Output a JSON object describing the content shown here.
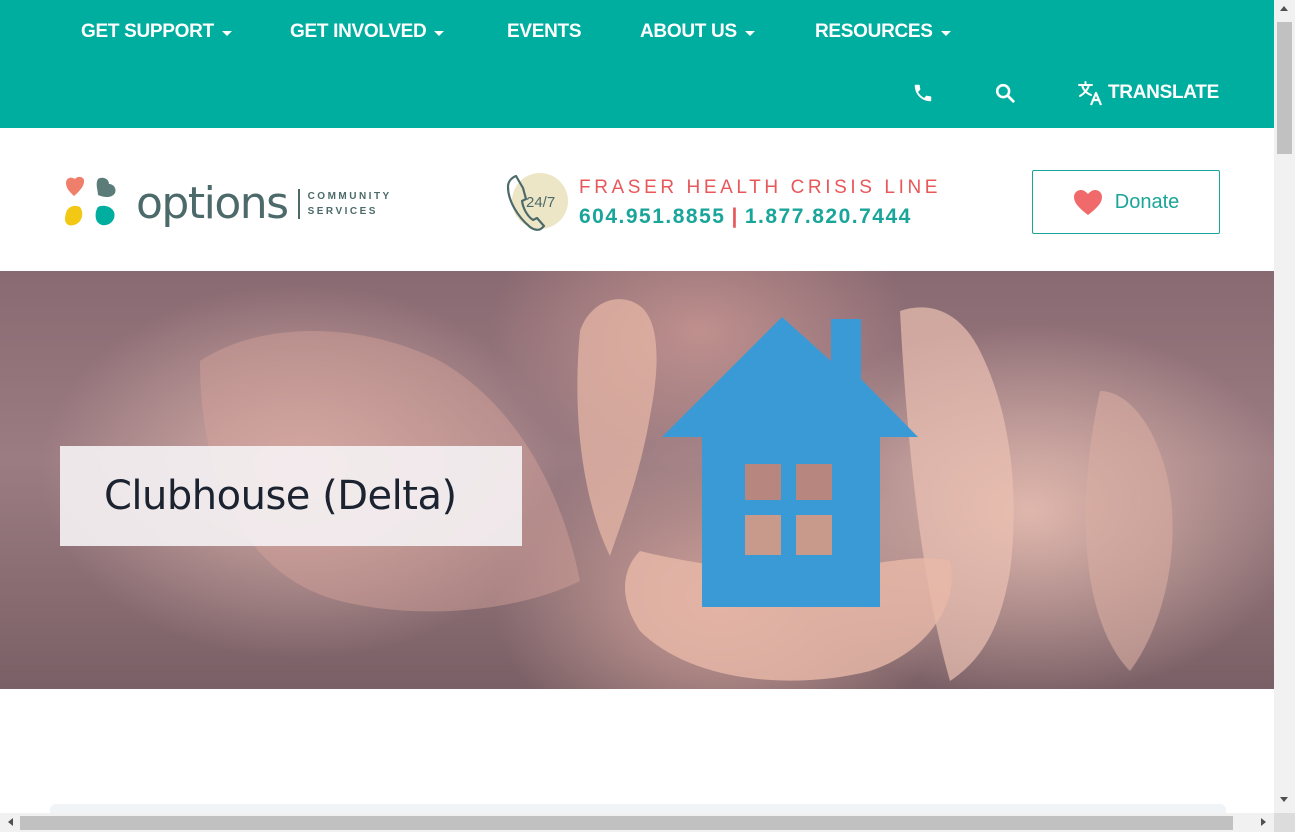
{
  "nav": {
    "items": [
      {
        "label": "GET SUPPORT",
        "dropdown": true
      },
      {
        "label": "GET INVOLVED",
        "dropdown": true
      },
      {
        "label": "EVENTS",
        "dropdown": false
      },
      {
        "label": "ABOUT US",
        "dropdown": true
      },
      {
        "label": "RESOURCES",
        "dropdown": true
      }
    ],
    "utility": {
      "phone_icon": "phone-icon",
      "search_icon": "search-icon",
      "translate_icon": "translate-icon",
      "translate_label": "TRANSLATE"
    }
  },
  "header": {
    "logo": {
      "word": "options",
      "sub_line1": "COMMUNITY",
      "sub_line2": "SERVICES"
    },
    "crisis": {
      "badge": "24/7",
      "title": "FRASER HEALTH CRISIS LINE",
      "phone1": "604.951.8855",
      "separator": "|",
      "phone2": "1.877.820.7444"
    },
    "donate": {
      "label": "Donate",
      "icon": "heart-icon"
    }
  },
  "hero": {
    "title": "Clubhouse (Delta)"
  },
  "colors": {
    "brand_teal": "#00ae9f",
    "accent_coral": "#e8575a",
    "text_teal": "#1aa59a",
    "logo_gray": "#4d6a6a",
    "house_blue": "#3a9ad6"
  }
}
